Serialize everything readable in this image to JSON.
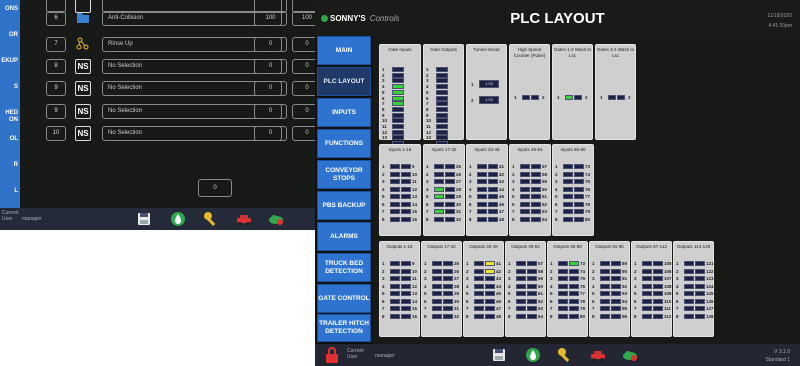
{
  "back_window": {
    "rail_labels": [
      "ONS",
      "OR",
      "EKUP",
      "S",
      "HED ON",
      "OL",
      "R",
      "L"
    ],
    "rows": [
      {
        "num": "",
        "icon": "",
        "field": "",
        "val1": "",
        "val2": ""
      },
      {
        "num": "6",
        "icon": "folder",
        "field": "Anti-Collision",
        "val1": "100",
        "val2": "100"
      },
      {
        "num": "7",
        "icon": "nodes",
        "field": "Rinse Up",
        "val1": "0",
        "val2": "0"
      },
      {
        "num": "8",
        "icon": "NS",
        "field": "No Selection",
        "val1": "0",
        "val2": "0"
      },
      {
        "num": "9",
        "icon": "NS",
        "field": "No Selection",
        "val1": "0",
        "val2": "0"
      },
      {
        "num": "9",
        "icon": "NS",
        "field": "No Selection",
        "val1": "0",
        "val2": "0"
      },
      {
        "num": "10",
        "icon": "NS",
        "field": "No Selection",
        "val1": "0",
        "val2": "0"
      }
    ],
    "page_box": "0",
    "footer": {
      "current_user_label": "Current User",
      "user": "manager"
    }
  },
  "front_window": {
    "logo": "SONNY'S",
    "logo_sub": "Controls",
    "title": "PLC LAYOUT",
    "date": "11/18/2020",
    "time": "4:41:30pm",
    "nav": [
      {
        "label": "MAIN",
        "active": false
      },
      {
        "label": "PLC LAYOUT",
        "active": true
      },
      {
        "label": "INPUTS",
        "active": false
      },
      {
        "label": "FUNCTIONS",
        "active": false
      },
      {
        "label": "CONVEYOR STOPS",
        "active": false
      },
      {
        "label": "PBS BACKUP",
        "active": false
      },
      {
        "label": "ALARMS",
        "active": false
      },
      {
        "label": "TRUCK BED DETECTION",
        "active": false
      },
      {
        "label": "GATE CONTROL",
        "active": false
      },
      {
        "label": "TRAILER HITCH DETECTION",
        "active": false
      }
    ],
    "row1_panels": [
      {
        "title": "Gate Inputs",
        "count": 16,
        "start": 1,
        "on": [
          3,
          4,
          5,
          6
        ]
      },
      {
        "title": "Gate Outputs",
        "count": 16,
        "start": 1,
        "on": []
      },
      {
        "title": "Tunnel Sonar",
        "count": 0,
        "start": 0,
        "on": []
      },
      {
        "title": "High Speed Counter (Pulse)",
        "count": 0,
        "start": 0,
        "on": []
      },
      {
        "title": "Gates 1-2 Wash to Lsc",
        "count": 0,
        "start": 0,
        "on": []
      },
      {
        "title": "Gates 3-4 Wash to Lsc",
        "count": 0,
        "start": 0,
        "on": []
      }
    ],
    "sonar_values": [
      "1.00",
      "1.00"
    ],
    "hsc_labels": [
      "1",
      "2"
    ],
    "gates12_labels": [
      "1",
      "2"
    ],
    "gates34_labels": [
      "1",
      "2"
    ],
    "inputs_panels": [
      {
        "title": "Inputs 1-16",
        "start": 1,
        "on": []
      },
      {
        "title": "Inputs 17-32",
        "start": 17,
        "on": [
          3,
          4,
          6
        ]
      },
      {
        "title": "Inputs 33-48",
        "start": 33,
        "on": []
      },
      {
        "title": "Inputs 49-64",
        "start": 49,
        "on": []
      },
      {
        "title": "Inputs 65-80",
        "start": 65,
        "on": []
      }
    ],
    "outputs_panels": [
      {
        "title": "Outputs 1-16",
        "start": 1,
        "on": [],
        "color": "y"
      },
      {
        "title": "Outputs 17-32",
        "start": 17,
        "on": [],
        "color": "y"
      },
      {
        "title": "Outputs 33-48",
        "start": 33,
        "on": [
          8,
          9
        ],
        "color": "y"
      },
      {
        "title": "Outputs 49-64",
        "start": 49,
        "on": [],
        "color": "y"
      },
      {
        "title": "Outputs 65-80",
        "start": 65,
        "on": [
          8
        ],
        "color": "g"
      },
      {
        "title": "Outputs 81-96",
        "start": 81,
        "on": [],
        "color": "y"
      },
      {
        "title": "Outputs 97-112",
        "start": 97,
        "on": [],
        "color": "y"
      },
      {
        "title": "Outputs 113-128",
        "start": 113,
        "on": [],
        "color": "y"
      }
    ],
    "footer": {
      "current_user_label": "Current User",
      "user": "manager",
      "version": "V 3.1.0",
      "site": "Standard 1"
    }
  }
}
